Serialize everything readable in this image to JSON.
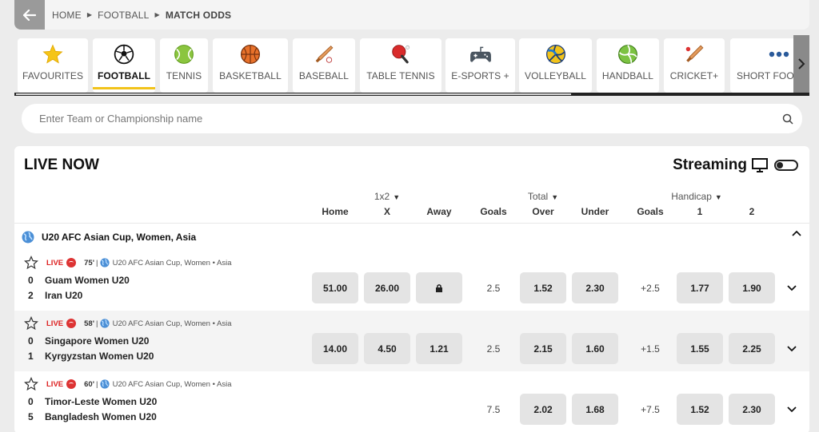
{
  "breadcrumb": {
    "items": [
      "HOME",
      "FOOTBALL",
      "MATCH ODDS"
    ]
  },
  "sports": [
    {
      "label": "FAVOURITES",
      "icon": "star-icon"
    },
    {
      "label": "FOOTBALL",
      "icon": "football-icon",
      "active": true
    },
    {
      "label": "TENNIS",
      "icon": "tennis-icon"
    },
    {
      "label": "BASKETBALL",
      "icon": "basketball-icon"
    },
    {
      "label": "BASEBALL",
      "icon": "baseball-icon"
    },
    {
      "label": "TABLE TENNIS",
      "icon": "table-tennis-icon"
    },
    {
      "label": "E-SPORTS +",
      "icon": "gamepad-icon"
    },
    {
      "label": "VOLLEYBALL",
      "icon": "volleyball-icon"
    },
    {
      "label": "HANDBALL",
      "icon": "handball-icon"
    },
    {
      "label": "CRICKET+",
      "icon": "cricket-icon"
    },
    {
      "label": "SHORT FOOTBA",
      "icon": "more-icon"
    }
  ],
  "search": {
    "placeholder": "Enter Team or Championship name"
  },
  "live": {
    "title": "LIVE NOW",
    "streaming": "Streaming",
    "groups": {
      "g1x2": "1x2",
      "total": "Total",
      "handicap": "Handicap"
    },
    "columns": {
      "home": "Home",
      "x": "X",
      "away": "Away",
      "goals1": "Goals",
      "over": "Over",
      "under": "Under",
      "goals2": "Goals",
      "h1": "1",
      "h2": "2"
    },
    "competition": "U20 AFC Asian Cup, Women, Asia",
    "matches": [
      {
        "minute": "75'",
        "tick": "|",
        "comp": "U20 AFC Asian Cup, Women • Asia",
        "live": "LIVE",
        "team1": {
          "score": "0",
          "name": "Guam Women U20"
        },
        "team2": {
          "score": "2",
          "name": "Iran U20"
        },
        "home": "51.00",
        "draw": "26.00",
        "away": "",
        "total_line": "2.5",
        "over": "1.52",
        "under": "2.30",
        "hcp_line": "+2.5",
        "h1": "1.77",
        "h2": "1.90"
      },
      {
        "minute": "58'",
        "tick": "|",
        "comp": "U20 AFC Asian Cup, Women • Asia",
        "live": "LIVE",
        "team1": {
          "score": "0",
          "name": "Singapore Women U20"
        },
        "team2": {
          "score": "1",
          "name": "Kyrgyzstan Women U20"
        },
        "home": "14.00",
        "draw": "4.50",
        "away": "1.21",
        "total_line": "2.5",
        "over": "2.15",
        "under": "1.60",
        "hcp_line": "+1.5",
        "h1": "1.55",
        "h2": "2.25"
      },
      {
        "minute": "60'",
        "tick": "|",
        "comp": "U20 AFC Asian Cup, Women • Asia",
        "live": "LIVE",
        "team1": {
          "score": "0",
          "name": "Timor-Leste Women U20"
        },
        "team2": {
          "score": "5",
          "name": "Bangladesh Women U20"
        },
        "home": "",
        "draw": "",
        "away": "",
        "total_line": "7.5",
        "over": "2.02",
        "under": "1.68",
        "hcp_line": "+7.5",
        "h1": "1.52",
        "h2": "2.30"
      }
    ]
  },
  "colors": {
    "accent": "#f2c31a",
    "live": "#d22222",
    "odd_bg": "#e4e4e4"
  }
}
